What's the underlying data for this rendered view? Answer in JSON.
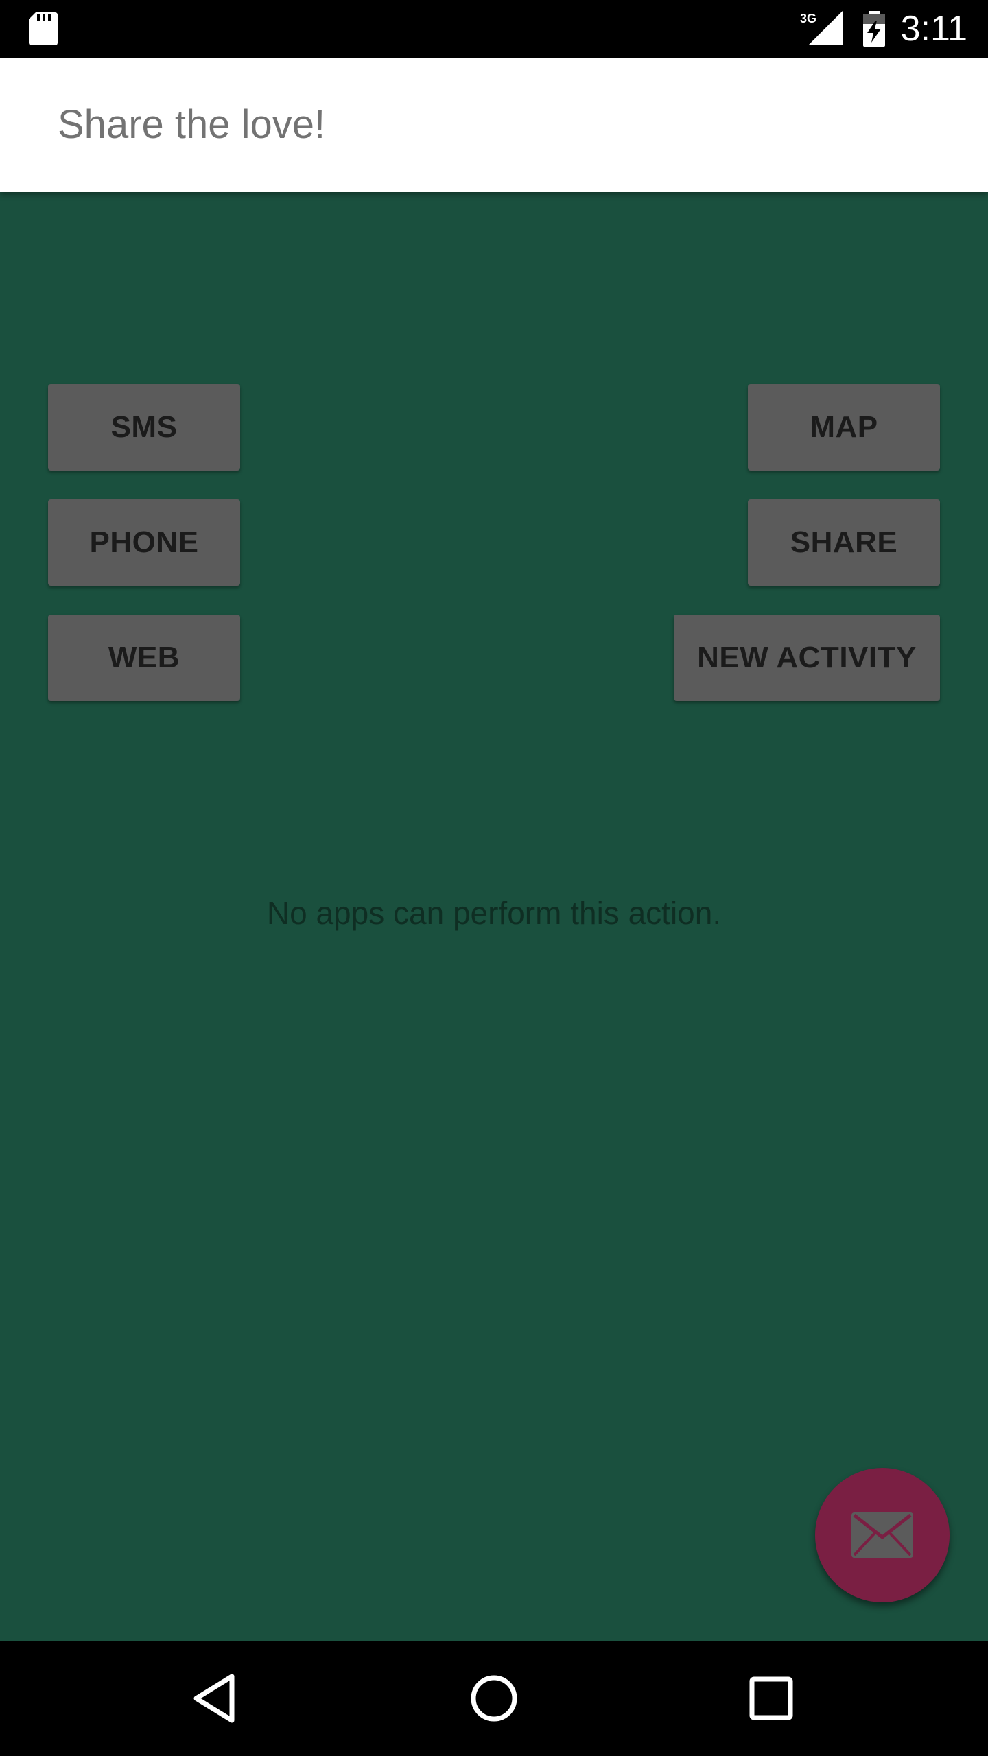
{
  "status_bar": {
    "network_type": "3G",
    "time": "3:11",
    "icons": [
      "sd-card-icon",
      "signal-icon",
      "battery-charging-icon"
    ]
  },
  "app_bar": {
    "title": "Share the love!"
  },
  "buttons": {
    "sms": "SMS",
    "phone": "PHONE",
    "web": "WEB",
    "map": "MAP",
    "share": "SHARE",
    "new_activity": "NEW ACTIVITY"
  },
  "message": "No apps can perform this action.",
  "fab": {
    "icon": "mail-icon"
  },
  "nav_bar": {
    "icons": [
      "back-icon",
      "home-icon",
      "recents-icon"
    ]
  },
  "colors": {
    "content_background": "#1a503e",
    "button_background": "#5b5b5b",
    "fab_background": "#7a1f43",
    "app_bar_background": "#ffffff"
  }
}
